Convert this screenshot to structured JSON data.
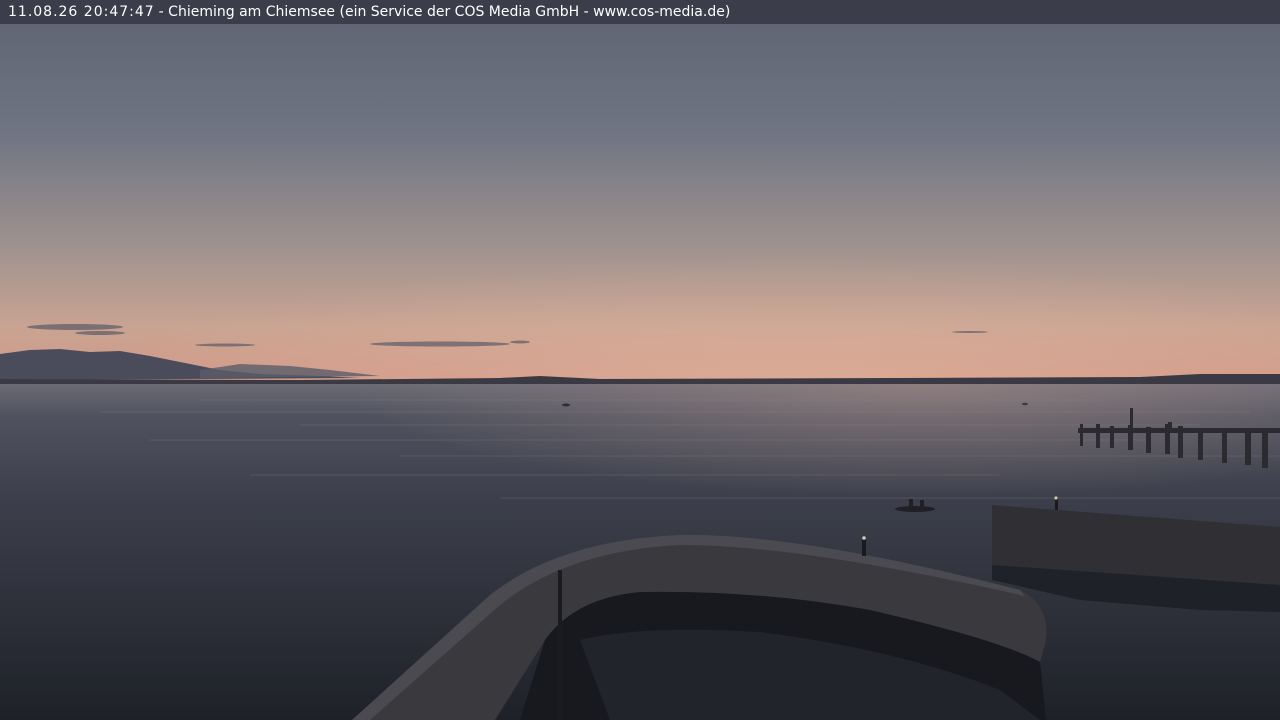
{
  "webcam": {
    "timestamp": "11.08.26 20:47:47",
    "caption": "- Chieming am Chiemsee (ein Service der COS Media GmbH - www.cos-media.de)"
  },
  "colors": {
    "caption_bar": "#3a3a48",
    "sky_top": "#5e6472",
    "sky_horizon": "#d89f8e",
    "water_far": "#8a8288",
    "water_near": "#23262e",
    "structures": "#26262a"
  }
}
